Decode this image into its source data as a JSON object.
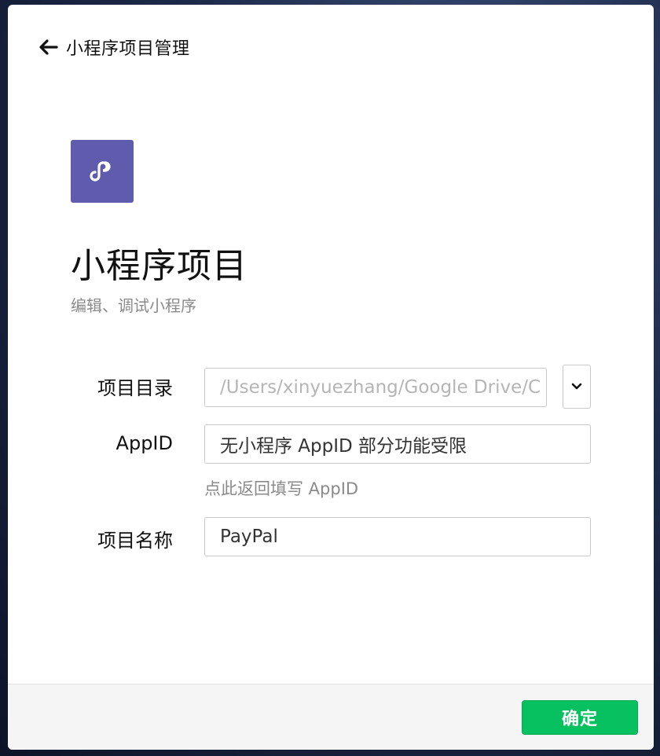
{
  "header": {
    "back_label": "小程序项目管理",
    "back_icon": "arrow-left-icon"
  },
  "app": {
    "logo_icon": "mini-program-logo-icon",
    "logo_color": "#5f5cae",
    "title": "小程序项目",
    "subtitle": "编辑、调试小程序"
  },
  "form": {
    "directory": {
      "label": "项目目录",
      "value": "/Users/xinyuezhang/Google Drive/C"
    },
    "appid": {
      "label": "AppID",
      "value": "无小程序 AppID 部分功能受限",
      "hint": "点此返回填写 AppID"
    },
    "project_name": {
      "label": "项目名称",
      "value": "PayPal"
    }
  },
  "footer": {
    "confirm_label": "确定",
    "confirm_color": "#07c160"
  }
}
